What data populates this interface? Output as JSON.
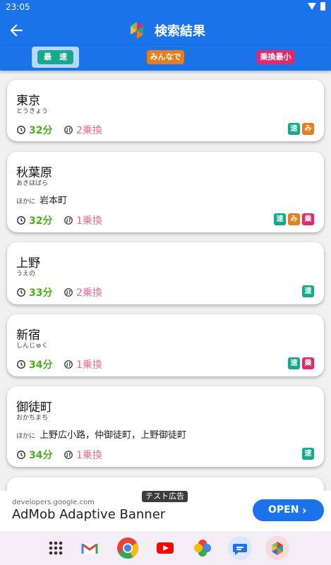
{
  "status_bar": {
    "time": "23:05"
  },
  "app_bar": {
    "title": "検索結果"
  },
  "tabs": [
    {
      "label": "最　速",
      "color": "#17a98c"
    },
    {
      "label": "みんなで",
      "color": "#e47e1e"
    },
    {
      "label": "乗換最小",
      "color": "#e6266a"
    }
  ],
  "results": [
    {
      "name": "東京",
      "kana": "とうきょう",
      "also_prefix": "",
      "also": "",
      "time": "32分",
      "transfers": "2乗換",
      "badges": [
        "速",
        "み"
      ]
    },
    {
      "name": "秋葉原",
      "kana": "あきはばら",
      "also_prefix": "ほかに",
      "also": "岩本町",
      "time": "32分",
      "transfers": "1乗換",
      "badges": [
        "速",
        "み",
        "乗"
      ]
    },
    {
      "name": "上野",
      "kana": "うえの",
      "also_prefix": "",
      "also": "",
      "time": "33分",
      "transfers": "2乗換",
      "badges": [
        "速"
      ]
    },
    {
      "name": "新宿",
      "kana": "しんじゅく",
      "also_prefix": "",
      "also": "",
      "time": "34分",
      "transfers": "1乗換",
      "badges": [
        "速",
        "乗"
      ]
    },
    {
      "name": "御徒町",
      "kana": "おかちまち",
      "also_prefix": "ほかに",
      "also": "上野広小路，仲御徒町，上野御徒町",
      "time": "34分",
      "transfers": "1乗換",
      "badges": [
        "速"
      ]
    }
  ],
  "ad": {
    "tag": "テスト広告",
    "url": "developers.google.com",
    "title": "AdMob Adaptive Banner",
    "cta": "OPEN"
  },
  "dock_icons": [
    "apps-grid-icon",
    "gmail-icon",
    "chrome-icon",
    "youtube-icon",
    "photos-icon",
    "messages-icon",
    "route-app-icon"
  ],
  "colors": {
    "primary": "#1a73e8",
    "time": "#4caf1f",
    "transfers": "#f06a8e"
  }
}
